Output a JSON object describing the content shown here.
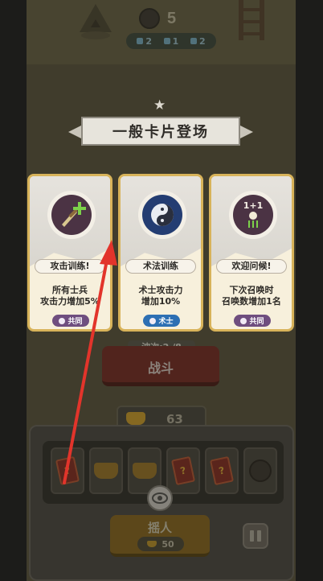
{
  "hud": {
    "unit_count": "5",
    "stats": [
      {
        "icon": "chat-bubble-icon",
        "value": "2"
      },
      {
        "icon": "bow-icon",
        "value": "1"
      },
      {
        "icon": "sword-icon",
        "value": "2"
      }
    ]
  },
  "banner": {
    "title": "一般卡片登场"
  },
  "cards": [
    {
      "title": "攻击训练!",
      "desc_line1": "所有士兵",
      "desc_line2": "攻击力增加5%",
      "tag": "共同",
      "tag_color": "#6f4e7f",
      "icon": "sword-plus-icon"
    },
    {
      "title": "术法训练",
      "desc_line1": "术士攻击力",
      "desc_line2": "增加10%",
      "tag": "术士",
      "tag_color": "#2d6fb3",
      "icon": "yin-yang-icon"
    },
    {
      "title": "欢迎问候!",
      "desc_line1": "下次召唤时",
      "desc_line2": "召唤数增加1名",
      "tag": "共同",
      "tag_color": "#6f4e7f",
      "icon": "summon-plus-one-icon",
      "icon_text": "1+1"
    }
  ],
  "battle": {
    "wave": "波次:2 /8",
    "button_label": "战斗"
  },
  "gold": {
    "value": "63"
  },
  "shake": {
    "label": "摇人",
    "cost": "50"
  },
  "slots": [
    "card",
    "gold",
    "gold",
    "card",
    "card",
    "avatar"
  ],
  "slot_card_mark": "?"
}
